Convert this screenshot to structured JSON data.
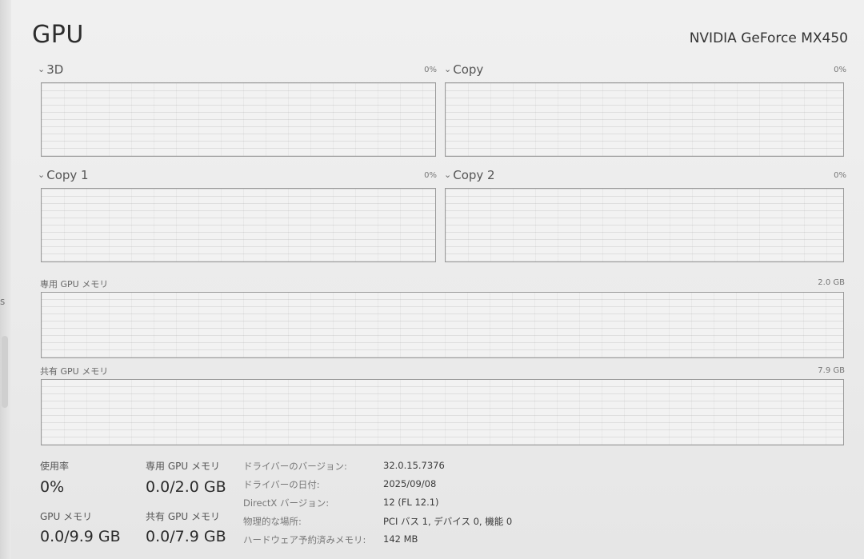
{
  "header": {
    "title": "GPU",
    "gpu_name": "NVIDIA GeForce MX450"
  },
  "engines": [
    {
      "label": "3D",
      "value": "0%"
    },
    {
      "label": "Copy",
      "value": "0%"
    },
    {
      "label": "Copy 1",
      "value": "0%"
    },
    {
      "label": "Copy 2",
      "value": "0%"
    }
  ],
  "icons": {
    "chevron": "chevron-down-icon"
  },
  "memory_graphs": {
    "dedicated": {
      "label": "専用 GPU メモリ",
      "max": "2.0 GB"
    },
    "shared": {
      "label": "共有 GPU メモリ",
      "max": "7.9 GB"
    }
  },
  "stats": {
    "utilization": {
      "label": "使用率",
      "value": "0%"
    },
    "dedicated_mem": {
      "label": "専用 GPU メモリ",
      "value": "0.0/2.0 GB"
    },
    "gpu_mem": {
      "label": "GPU メモリ",
      "value": "0.0/9.9 GB"
    },
    "shared_mem": {
      "label": "共有 GPU メモリ",
      "value": "0.0/7.9 GB"
    }
  },
  "info": [
    {
      "label": "ドライバーのバージョン:",
      "value": "32.0.15.7376"
    },
    {
      "label": "ドライバーの日付:",
      "value": "2025/09/08"
    },
    {
      "label": "DirectX バージョン:",
      "value": "12 (FL 12.1)"
    },
    {
      "label": "物理的な場所:",
      "value": "PCI バス 1, デバイス 0, 機能 0"
    },
    {
      "label": "ハードウェア予約済みメモリ:",
      "value": "142 MB"
    }
  ],
  "left_edge_mark": "s"
}
